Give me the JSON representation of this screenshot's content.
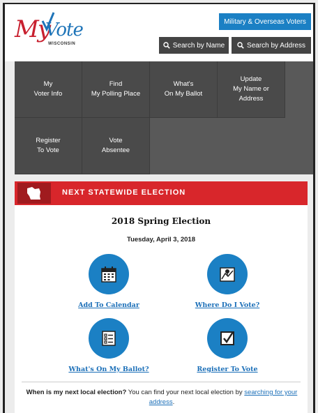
{
  "header": {
    "logo_my": "My",
    "logo_vote": "Vote",
    "logo_sub": "WISCONSIN",
    "military_label": "Military & Overseas Voters",
    "search_name_label": "Search by Name",
    "search_address_label": "Search by Address"
  },
  "nav": {
    "items": [
      {
        "label": "My\nVoter Info"
      },
      {
        "label": "Find\nMy Polling Place"
      },
      {
        "label": "What's\nOn My Ballot"
      },
      {
        "label": "Update\nMy Name or\nAddress"
      },
      {
        "label": "Register\nTo Vote"
      },
      {
        "label": "Vote\nAbsentee"
      }
    ]
  },
  "election": {
    "banner_title": "NEXT STATEWIDE ELECTION",
    "title": "2018 Spring Election",
    "date": "Tuesday, April 3, 2018",
    "actions": [
      {
        "label": "Add To Calendar",
        "icon": "calendar-icon"
      },
      {
        "label": "Where Do I Vote?",
        "icon": "map-icon"
      },
      {
        "label": "What's On My Ballot?",
        "icon": "ballot-list-icon"
      },
      {
        "label": "Register To Vote",
        "icon": "checkbox-icon"
      }
    ],
    "footer_bold": "When is my next local election?",
    "footer_text": " You can find your next local election by ",
    "footer_link": "searching for your address",
    "footer_end": "."
  },
  "colors": {
    "accent_blue": "#1b80c4",
    "banner_red": "#d8262b",
    "nav_gray": "#4a4a4a"
  }
}
